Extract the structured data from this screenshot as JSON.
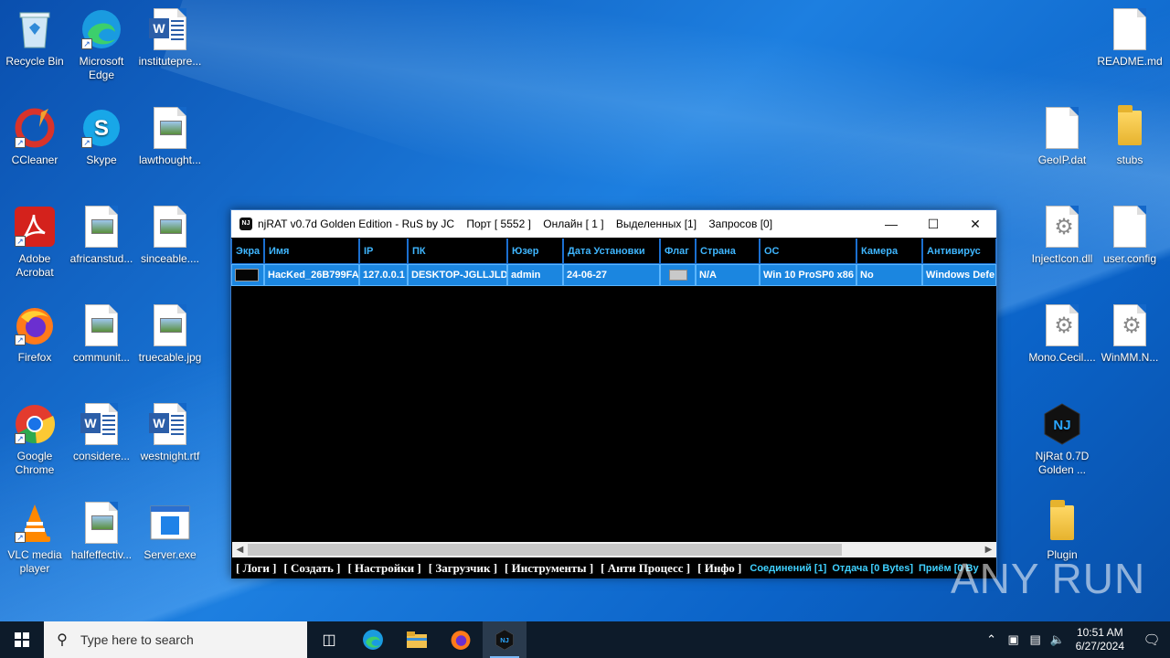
{
  "desktop": {
    "left_icons": [
      {
        "name": "recycle-bin-icon",
        "label": "Recycle Bin"
      },
      {
        "name": "edge-icon",
        "label": "Microsoft Edge"
      },
      {
        "name": "word-doc-icon",
        "label": "institutepre..."
      },
      {
        "name": "ccleaner-icon",
        "label": "CCleaner"
      },
      {
        "name": "skype-icon",
        "label": "Skype"
      },
      {
        "name": "image-file-icon",
        "label": "lawthought..."
      },
      {
        "name": "acrobat-icon",
        "label": "Adobe Acrobat"
      },
      {
        "name": "image-file-icon",
        "label": "africanstud..."
      },
      {
        "name": "image-file-icon",
        "label": "sinceable...."
      },
      {
        "name": "firefox-icon",
        "label": "Firefox"
      },
      {
        "name": "image-file-icon",
        "label": "communit..."
      },
      {
        "name": "image-file-icon",
        "label": "truecable.jpg"
      },
      {
        "name": "chrome-icon",
        "label": "Google Chrome"
      },
      {
        "name": "word-doc-icon",
        "label": "considere..."
      },
      {
        "name": "word-doc-icon",
        "label": "westnight.rtf"
      },
      {
        "name": "vlc-icon",
        "label": "VLC media player"
      },
      {
        "name": "image-file-icon",
        "label": "halfeffectiv..."
      },
      {
        "name": "exe-file-icon",
        "label": "Server.exe"
      }
    ],
    "right_icons": [
      {
        "name": "text-file-icon",
        "label": "README.md"
      },
      {
        "name": "text-file-icon",
        "label": "GeoIP.dat"
      },
      {
        "name": "folder-icon",
        "label": "stubs"
      },
      {
        "name": "dll-file-icon",
        "label": "InjectIcon.dll"
      },
      {
        "name": "text-file-icon",
        "label": "user.config"
      },
      {
        "name": "dll-file-icon",
        "label": "Mono.Cecil...."
      },
      {
        "name": "dll-file-icon",
        "label": "WinMM.N..."
      },
      {
        "name": "njrat-app-icon",
        "label": "NjRat 0.7D Golden ..."
      },
      {
        "name": "folder-icon",
        "label": "Plugin"
      }
    ]
  },
  "window": {
    "title": "njRAT v0.7d Golden Edition - RuS by JC",
    "port": "Порт [ 5552 ]",
    "online": "Онлайн [ 1 ]",
    "selected": "Выделенных [1]",
    "requests": "Запросов [0]",
    "minimize": "—",
    "maximize": "☐",
    "close": "✕"
  },
  "table": {
    "headers": [
      "Экра",
      "Имя",
      "IP",
      "ПК",
      "Юзер",
      "Дата Установки",
      "Флаг",
      "Страна",
      "ОС",
      "Камера",
      "Антивирус"
    ],
    "rows": [
      {
        "name": "HacKed_26B799FA",
        "ip": "127.0.0.1",
        "pc": "DESKTOP-JGLLJLD",
        "user": "admin",
        "date": "24-06-27",
        "country": "N/A",
        "os": "Win 10 ProSP0 x86",
        "camera": "No",
        "antivirus": "Windows Defe"
      }
    ]
  },
  "statusbar": {
    "menu": [
      "[ Логи ]",
      "[ Создать ]",
      "[ Настройки ]",
      "[ Загрузчик ]",
      "[ Инструменты ]",
      "[ Анти Процесс ]",
      "[ Инфо ]"
    ],
    "connections": "Соединений [1]",
    "upload": "Отдача [0 Bytes]",
    "download": "Приём [0 By"
  },
  "watermark": "ANY RUN",
  "taskbar": {
    "search_placeholder": "Type here to search",
    "time": "10:51 AM",
    "date": "6/27/2024"
  }
}
